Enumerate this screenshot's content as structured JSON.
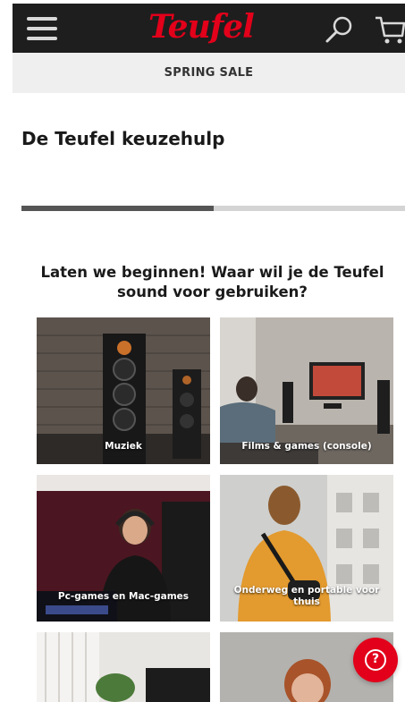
{
  "header": {
    "logo_text": "Teufel",
    "menu_icon": "hamburger-menu-icon",
    "search_icon": "search-icon",
    "cart_icon": "cart-icon",
    "brand_color": "#e2001a"
  },
  "promo": {
    "label": "SPRING SALE"
  },
  "page": {
    "title": "De Teufel keuzehulp",
    "progress": 0.5,
    "question": "Laten we beginnen! Waar wil je de Teufel sound voor gebruiken?"
  },
  "options": [
    {
      "label": "Muziek"
    },
    {
      "label": "Films & games (console)"
    },
    {
      "label": "Pc-games en Mac-games"
    },
    {
      "label": "Onderweg en portable voor thuis"
    }
  ],
  "help_button": {
    "icon": "question-circle-icon",
    "glyph": "?"
  }
}
